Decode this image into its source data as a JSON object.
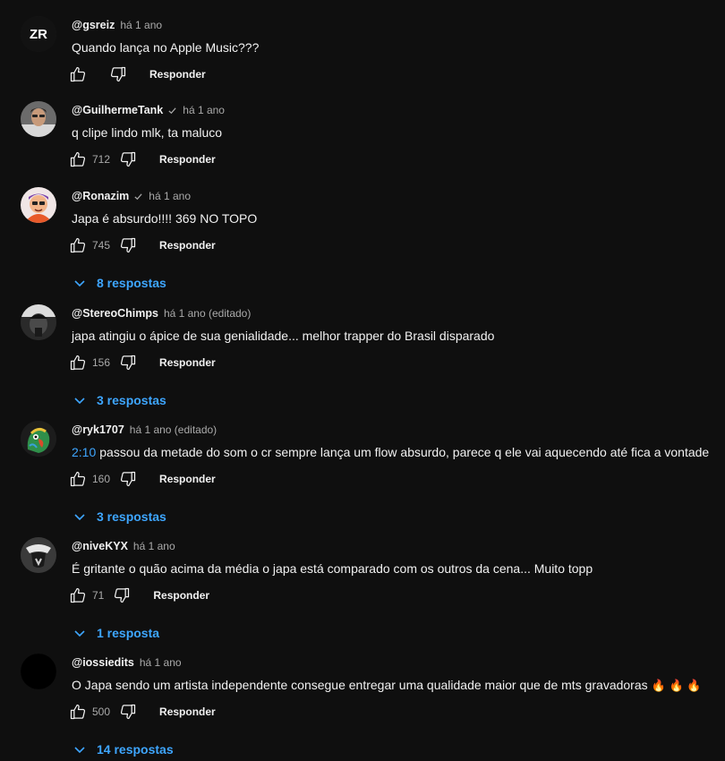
{
  "comments": [
    {
      "author": "@gsreiz",
      "time": "há 1 ano",
      "text": "Quando lança no Apple Music???",
      "likes": "",
      "reply_label": "Responder",
      "replies_label": "",
      "avatar": {
        "kind": "monogram",
        "letters": "ZR",
        "bg": "#121212",
        "fg": "#ffffff"
      }
    },
    {
      "author": "@GuilhermeTank",
      "time": "há 1 ano",
      "text": "q clipe lindo mlk, ta maluco",
      "likes": "712",
      "reply_label": "Responder",
      "replies_label": "",
      "avatar": {
        "kind": "photo-person",
        "bg": "#6b6b6b"
      }
    },
    {
      "author": "@Ronazim",
      "time": "há 1 ano",
      "text": "Japa é absurdo!!!! 369 NO TOPO",
      "likes": "745",
      "reply_label": "Responder",
      "replies_label": "8 respostas",
      "avatar": {
        "kind": "cartoon",
        "bg": "#e85a2a"
      }
    },
    {
      "author": "@StereoChimps",
      "time": "há 1 ano (editado)",
      "text": "japa atingiu o ápice de sua genialidade... melhor trapper do Brasil disparado",
      "likes": "156",
      "reply_label": "Responder",
      "replies_label": "3 respostas",
      "avatar": {
        "kind": "photo-bw",
        "bg": "#2a2a2a"
      }
    },
    {
      "author": "@ryk1707",
      "time": "há 1 ano (editado)",
      "timestamp": "2:10",
      "text": "passou da metade do som o cr sempre lança um flow absurdo, parece q ele vai aquecendo até fica a vontade",
      "likes": "160",
      "reply_label": "Responder",
      "replies_label": "3 respostas",
      "avatar": {
        "kind": "parrot",
        "bg": "#1c1c1c"
      }
    },
    {
      "author": "@niveKYX",
      "time": "há 1 ano",
      "text": "É gritante o quão acima da média o japa está comparado com os outros da cena... Muito topp",
      "likes": "71",
      "reply_label": "Responder",
      "replies_label": "1 resposta",
      "avatar": {
        "kind": "mask",
        "bg": "#3a3a3a"
      }
    },
    {
      "author": "@iossiedits",
      "time": "há 1 ano",
      "text": "O Japa sendo um artista independente consegue entregar uma qualidade maior que de mts gravadoras",
      "emoji": "🔥 🔥 🔥",
      "likes": "500",
      "reply_label": "Responder",
      "replies_label": "14 respostas",
      "avatar": {
        "kind": "blank",
        "bg": "#000000"
      }
    }
  ],
  "icons": {
    "like": "thumbs-up-icon",
    "dislike": "thumbs-down-icon",
    "verified": "check-icon",
    "expand": "chevron-down-icon"
  },
  "colors": {
    "background": "#0f0f0f",
    "link": "#3ea6ff",
    "secondary_text": "#aaaaaa"
  }
}
